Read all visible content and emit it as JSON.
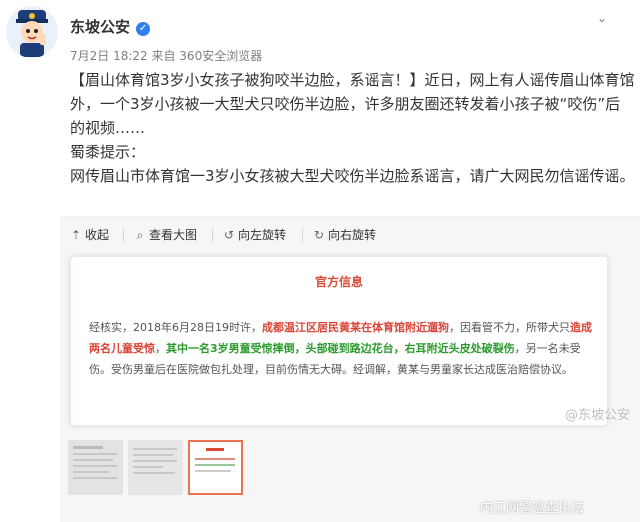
{
  "post": {
    "author": "东坡公安",
    "meta": "7月2日 18:22 来自 360安全浏览器",
    "text_1": "【眉山体育馆3岁小女孩子被狗咬半边脸，系谣言！】近日，网上有人谣传眉山体育馆外，一个3岁小孩被一大型犬只咬伤半边脸，许多朋友圈还转发着小孩子被“咬伤”后的视频……",
    "text_2": "蜀黍提示：",
    "text_3": "网传眉山市体育馆一3岁小女孩被大型犬咬伤半边脸系谣言，请广大网民勿信谣传谣。"
  },
  "toolbar": {
    "collapse": "收起",
    "view_large": "查看大图",
    "rotate_left": "向左旋转",
    "rotate_right": "向右旋转"
  },
  "notice": {
    "title": "官方信息",
    "p1": "经核实，2018年6月28日19时许，",
    "p1_red": "成都温江区居民黄某在体育馆附近遛狗",
    "p1_end": "，因看管不力，所带犬只",
    "p2_red": "造成两名儿童受惊",
    "p2_mid": "，",
    "p2_green": "其中一名3岁男童受惊摔倒，头部碰到路边花台，右耳附近头皮处破裂伤",
    "p2_end": "，",
    "p3": "另一名未受伤。受伤男童后在医院做包扎处理，目前伤情无大碍。经调解，黄某与男童家长达成医治赔偿协议。",
    "stamp": "@东坡公安"
  },
  "watermark": "内江网警巡查执法",
  "icons": {
    "collapse": "arrow-up-icon",
    "view_large": "zoom-icon",
    "rotate_left": "rotate-left-icon",
    "rotate_right": "rotate-right-icon"
  }
}
